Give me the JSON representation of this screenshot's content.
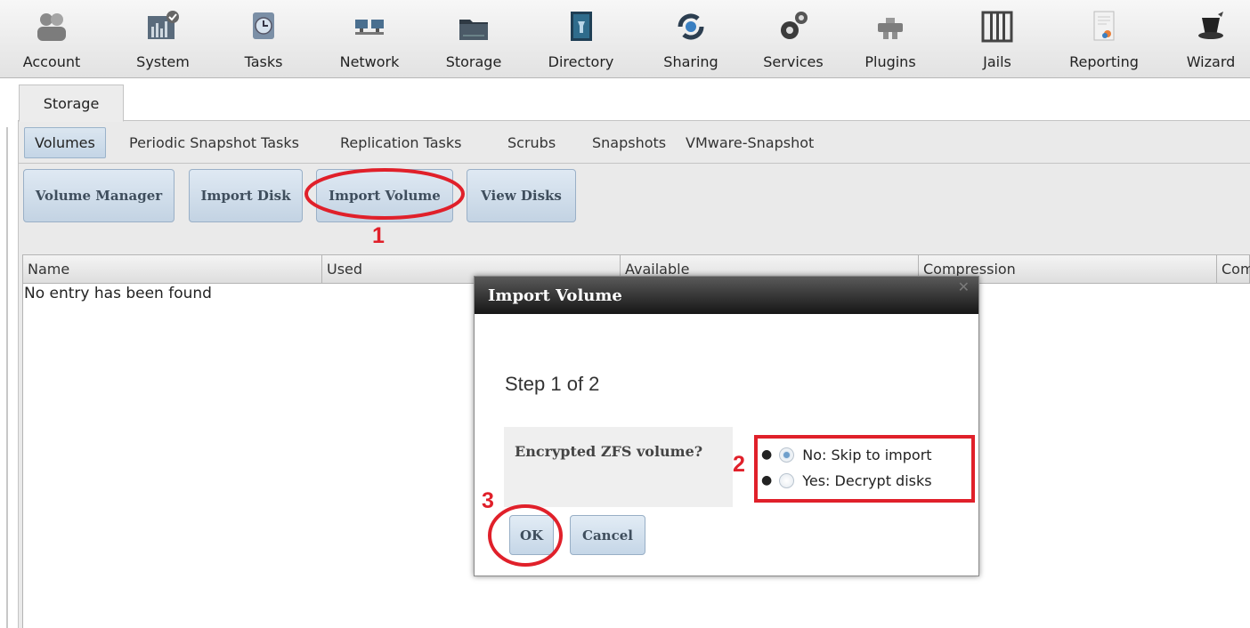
{
  "toolbar": {
    "items": [
      {
        "label": "Account",
        "icon": "account-icon"
      },
      {
        "label": "System",
        "icon": "system-icon"
      },
      {
        "label": "Tasks",
        "icon": "tasks-icon"
      },
      {
        "label": "Network",
        "icon": "network-icon"
      },
      {
        "label": "Storage",
        "icon": "storage-icon"
      },
      {
        "label": "Directory",
        "icon": "directory-icon"
      },
      {
        "label": "Sharing",
        "icon": "sharing-icon"
      },
      {
        "label": "Services",
        "icon": "services-icon"
      },
      {
        "label": "Plugins",
        "icon": "plugins-icon"
      },
      {
        "label": "Jails",
        "icon": "jails-icon"
      },
      {
        "label": "Reporting",
        "icon": "reporting-icon"
      },
      {
        "label": "Wizard",
        "icon": "wizard-icon"
      }
    ]
  },
  "main_tab": {
    "label": "Storage"
  },
  "sub_tabs": [
    {
      "label": "Volumes",
      "active": true
    },
    {
      "label": "Periodic Snapshot Tasks"
    },
    {
      "label": "Replication Tasks"
    },
    {
      "label": "Scrubs"
    },
    {
      "label": "Snapshots"
    },
    {
      "label": "VMware-Snapshot"
    }
  ],
  "actions": {
    "volume_manager": "Volume Manager",
    "import_disk": "Import Disk",
    "import_volume": "Import Volume",
    "view_disks": "View Disks"
  },
  "table": {
    "columns": [
      "Name",
      "Used",
      "Available",
      "Compression",
      "Com"
    ],
    "empty_text": "No entry has been found"
  },
  "annotations": {
    "step1": "1",
    "step2": "2",
    "step3": "3",
    "color": "#e0202a"
  },
  "dialog": {
    "title": "Import Volume",
    "step_text": "Step 1 of 2",
    "question": "Encrypted ZFS volume?",
    "options": [
      {
        "label": "No: Skip to import",
        "selected": true
      },
      {
        "label": "Yes: Decrypt disks",
        "selected": false
      }
    ],
    "ok_label": "OK",
    "cancel_label": "Cancel"
  },
  "colors": {
    "button_bg": "#c3d3e3",
    "dialog_title_bg": "#161616",
    "annotation_red": "#e0202a"
  }
}
